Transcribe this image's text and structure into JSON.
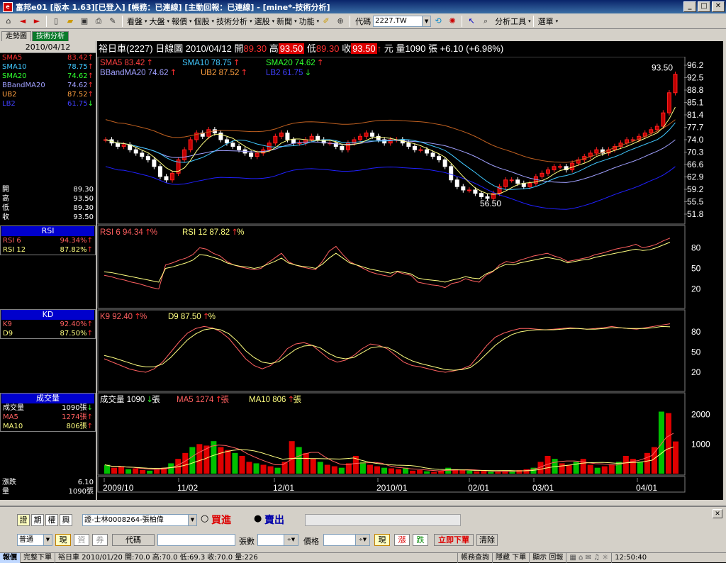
{
  "window": {
    "title": "富邦e01 [版本 1.63][已登入] [帳務：已連線] [主動回報：已連線] - [mine*-技術分析]"
  },
  "toolbar": {
    "menus": [
      "看盤",
      "大盤",
      "報價",
      "個股",
      "技術分析",
      "選股",
      "新聞",
      "功能"
    ],
    "code_label": "代碼",
    "code_value": "2227.TW",
    "analysis_tools": "分析工具",
    "options": "選單"
  },
  "tabs": [
    "走勢圖",
    "技術分析"
  ],
  "left": {
    "date": "2010/04/12",
    "ma": [
      {
        "name": "SMA5",
        "value": "83.42",
        "color": "#ff3030",
        "arrow": "up"
      },
      {
        "name": "SMA10",
        "value": "78.75",
        "color": "#40c8ff",
        "arrow": "up"
      },
      {
        "name": "SMA20",
        "value": "74.62",
        "color": "#30ff30",
        "arrow": "up"
      },
      {
        "name": "BBandMA20",
        "value": "74.62",
        "color": "#a0a0ff",
        "arrow": "up"
      },
      {
        "name": "UB2",
        "value": "87.52",
        "color": "#ffa040",
        "arrow": "up"
      },
      {
        "name": "LB2",
        "value": "61.75",
        "color": "#4040ff",
        "arrow": "down"
      }
    ],
    "ohlc": [
      {
        "name": "開",
        "value": "89.30"
      },
      {
        "name": "高",
        "value": "93.50"
      },
      {
        "name": "低",
        "value": "89.30"
      },
      {
        "name": "收",
        "value": "93.50"
      }
    ],
    "rsi_hdr": "RSI",
    "rsi": [
      {
        "name": "RSI 6",
        "value": "94.34%",
        "color": "#ff6060"
      },
      {
        "name": "RSI 12",
        "value": "87.82%",
        "color": "#ffff80"
      }
    ],
    "kd_hdr": "KD",
    "kd": [
      {
        "name": "K9",
        "value": "92.40%",
        "color": "#ff6060"
      },
      {
        "name": "D9",
        "value": "87.50%",
        "color": "#ffff80"
      }
    ],
    "vol_hdr": "成交量",
    "vol": [
      {
        "name": "成交量",
        "value": "1090張",
        "color": "#ffffff",
        "arrow": "down"
      },
      {
        "name": "MA5",
        "value": "1274張",
        "color": "#ff6060",
        "arrow": "up"
      },
      {
        "name": "MA10",
        "value": "806張",
        "color": "#ffff80",
        "arrow": "up"
      }
    ],
    "chg": {
      "name": "漲跌",
      "value": "6.10"
    },
    "qty": {
      "name": "量",
      "value": "1090張"
    }
  },
  "header": {
    "stock": "裕日車(2227) 日線圖 2010/04/12",
    "open_label": "開",
    "open": "89.30",
    "high_label": "高",
    "high": "93.50",
    "low_label": "低",
    "low": "89.30",
    "close_label": "收",
    "close": "93.50",
    "unit": "元",
    "vol_label": "量",
    "vol": "1090 張",
    "change": "+6.10 (+6.98%)"
  },
  "legends": {
    "sma5": "SMA5 83.42",
    "sma10": "SMA10 78.75",
    "sma20": "SMA20 74.62",
    "bbma": "BBandMA20 74.62",
    "ub2": "UB2 87.52",
    "lb2": "LB2 61.75",
    "rsi6": "RSI 6 94.34",
    "rsi12": "RSI 12 87.82",
    "k9": "K9 92.40",
    "d9": "D9 87.50",
    "vol": "成交量 1090",
    "vma5": "MA5 1274",
    "vma10": "MA10 806",
    "pct": "%",
    "zhang": "張"
  },
  "chart_data": {
    "type": "candlestick",
    "price_axis": [
      "96.2",
      "92.5",
      "88.8",
      "85.1",
      "81.4",
      "77.7",
      "74.0",
      "70.3",
      "66.6",
      "62.9",
      "59.2",
      "55.5",
      "51.8"
    ],
    "price_range": [
      51.8,
      96.2
    ],
    "max_label": "93.50",
    "min_label": "56.50",
    "x_labels": [
      "2009/10",
      "11/02",
      "12/01",
      "2010/01",
      "02/01",
      "03/01",
      "04/01"
    ],
    "rsi_axis": [
      "80",
      "50",
      "20"
    ],
    "kd_axis": [
      "80",
      "50",
      "20"
    ],
    "vol_axis": [
      "2000",
      "1000"
    ],
    "closes": [
      74,
      73,
      72,
      72.5,
      71,
      70,
      69,
      68,
      66,
      63,
      62,
      64,
      68,
      71,
      74,
      76,
      75,
      77,
      76,
      74,
      73,
      72,
      71,
      70,
      69,
      70,
      71,
      73,
      75,
      76,
      74,
      73,
      73,
      74,
      75,
      74,
      73,
      73,
      72,
      71,
      73,
      74,
      75,
      76,
      75,
      74,
      73,
      74,
      74,
      73,
      72,
      71,
      71,
      70,
      69,
      68,
      66,
      62,
      60,
      59,
      59,
      58,
      57,
      56.5,
      58,
      60,
      62,
      62,
      61,
      60,
      61,
      63,
      64,
      65,
      66,
      66,
      65,
      67,
      68,
      69,
      70,
      71,
      70,
      71,
      72,
      73,
      74,
      74,
      75,
      76,
      77,
      78,
      82,
      88,
      93.5
    ],
    "rsi6": [
      40,
      38,
      35,
      33,
      30,
      28,
      25,
      22,
      20,
      55,
      58,
      62,
      65,
      70,
      80,
      78,
      72,
      68,
      60,
      55,
      52,
      50,
      48,
      50,
      58,
      65,
      72,
      60,
      55,
      52,
      50,
      48,
      60,
      75,
      82,
      70,
      60,
      55,
      50,
      45,
      42,
      40,
      38,
      45,
      42,
      40,
      30,
      28,
      26,
      25,
      22,
      28,
      30,
      35,
      32,
      30,
      40,
      45,
      55,
      60,
      58,
      62,
      65,
      68,
      70,
      72,
      68,
      65,
      60,
      62,
      64,
      66,
      70,
      72,
      75,
      78,
      80,
      82,
      85,
      80,
      82,
      85,
      90,
      94
    ],
    "rsi12": [
      45,
      44,
      42,
      40,
      38,
      36,
      34,
      32,
      30,
      50,
      52,
      55,
      58,
      62,
      70,
      69,
      66,
      63,
      58,
      55,
      53,
      52,
      50,
      52,
      56,
      60,
      65,
      58,
      55,
      53,
      52,
      50,
      56,
      65,
      72,
      65,
      58,
      55,
      52,
      49,
      47,
      45,
      43,
      46,
      44,
      42,
      36,
      34,
      33,
      32,
      30,
      33,
      35,
      38,
      36,
      35,
      42,
      46,
      52,
      56,
      55,
      58,
      60,
      62,
      64,
      66,
      64,
      62,
      58,
      60,
      62,
      63,
      66,
      68,
      70,
      72,
      74,
      76,
      78,
      76,
      77,
      80,
      84,
      88
    ],
    "k9": [
      40,
      35,
      30,
      25,
      22,
      20,
      25,
      35,
      50,
      65,
      78,
      85,
      88,
      86,
      80,
      70,
      55,
      40,
      30,
      25,
      30,
      40,
      55,
      62,
      64,
      60,
      50,
      40,
      35,
      38,
      45,
      55,
      62,
      60,
      55,
      45,
      35,
      30,
      28,
      25,
      22,
      20,
      22,
      25,
      30,
      45,
      60,
      72,
      78,
      82,
      85,
      85,
      84,
      83,
      84,
      85,
      86,
      85,
      84,
      85,
      86,
      88,
      86,
      85,
      84,
      86,
      88,
      90,
      92
    ],
    "d9": [
      45,
      42,
      38,
      34,
      30,
      28,
      28,
      32,
      42,
      55,
      68,
      77,
      83,
      85,
      83,
      77,
      66,
      52,
      42,
      35,
      33,
      36,
      45,
      54,
      59,
      60,
      56,
      48,
      42,
      40,
      42,
      49,
      56,
      58,
      57,
      51,
      43,
      37,
      33,
      30,
      27,
      24,
      23,
      24,
      27,
      36,
      48,
      60,
      69,
      76,
      80,
      82,
      83,
      83,
      83,
      84,
      85,
      85,
      84,
      84,
      85,
      86,
      86,
      85,
      85,
      85,
      86,
      88,
      87.5
    ],
    "volumes": [
      300,
      200,
      250,
      150,
      180,
      120,
      100,
      150,
      200,
      350,
      500,
      700,
      900,
      1000,
      950,
      1100,
      900,
      800,
      700,
      600,
      400,
      350,
      300,
      250,
      200,
      400,
      1100,
      900,
      700,
      500,
      400,
      300,
      250,
      200,
      350,
      600,
      400,
      300,
      250,
      200,
      180,
      150,
      200,
      100,
      120,
      80,
      60,
      100,
      200,
      150,
      120,
      100,
      80,
      90,
      70,
      60,
      80,
      100,
      120,
      150,
      200,
      400,
      600,
      500,
      350,
      300,
      400,
      500,
      300,
      200,
      250,
      300,
      400,
      600,
      500,
      400,
      700,
      900,
      2100,
      2050,
      1090
    ]
  },
  "order": {
    "side_tab": "下單",
    "type_btns": [
      "證",
      "期",
      "權",
      "興"
    ],
    "account": "證-士林0008264-張柏偉",
    "buy": "買進",
    "sell": "賣出",
    "mode": "普通",
    "now_btn": "現",
    "cash_btn": "資",
    "lend_btn": "券",
    "code_btn": "代碼",
    "qty_label": "張數",
    "price_label": "價格",
    "now2": "現",
    "up": "漲",
    "down": "跌",
    "place": "立即下單",
    "clear": "清除"
  },
  "status": {
    "quote": "報價",
    "full": "完整下單",
    "ticker": "裕日車 2010/01/20 開:70.0 高:70.0 低:69.3 收:70.0 量:226",
    "acct": "帳務查詢",
    "hide": "隱藏 下單",
    "report": "顯示 回報",
    "time": "12:50:40"
  }
}
